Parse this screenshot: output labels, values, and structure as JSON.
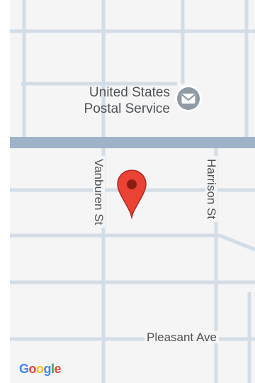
{
  "map": {
    "poi": {
      "name_line1": "United States",
      "name_line2": "Postal Service",
      "icon": "mail-icon"
    },
    "streets": {
      "vanburen": "Vanburen St",
      "harrison": "Harrison St",
      "pleasant": "Pleasant Ave"
    },
    "marker": {
      "icon": "location-pin-icon",
      "color": "#ea4335"
    },
    "attribution": {
      "logo_letters": [
        "G",
        "o",
        "o",
        "g",
        "l",
        "e"
      ],
      "logo_colors": [
        "#4285f4",
        "#ea4335",
        "#fbbc05",
        "#4285f4",
        "#34a853",
        "#ea4335"
      ]
    },
    "colors": {
      "background": "#f5f5f5",
      "road": "#d3dde6",
      "highway": "#9fb3c8",
      "poi_icon": "#8e9aa6"
    }
  }
}
